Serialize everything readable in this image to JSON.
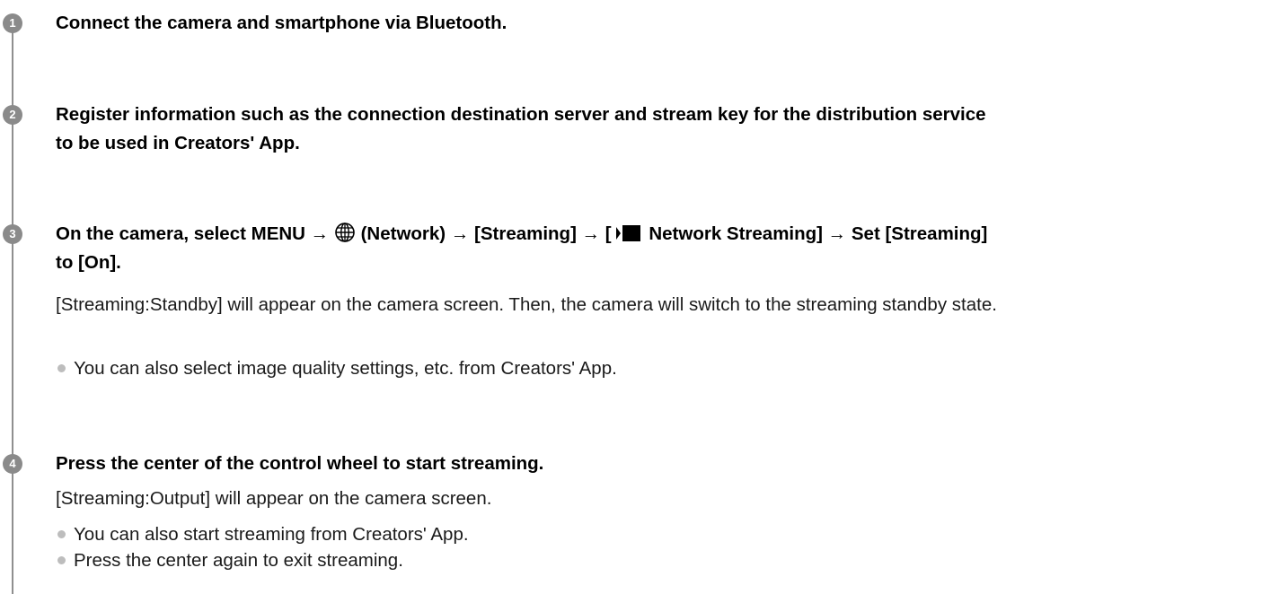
{
  "steps": [
    {
      "number": "1",
      "title": "Connect the camera and smartphone via Bluetooth."
    },
    {
      "number": "2",
      "title_line1": "Register information such as the connection destination server and stream key for the distribution service",
      "title_line2": "to be used in Creators' App."
    },
    {
      "number": "3",
      "title_part1": "On the camera, select MENU → ",
      "title_part2": " (Network) → [Streaming] → [",
      "title_part3": " Network Streaming] → Set [Streaming]",
      "title_line2": "to [On].",
      "description": "[Streaming:Standby] will appear on the camera screen. Then, the camera will switch to the streaming standby state.",
      "bullets": [
        "You can also select image quality settings, etc. from Creators' App."
      ],
      "icons": [
        "globe-network-icon",
        "movie-streaming-icon"
      ]
    },
    {
      "number": "4",
      "title": "Press the center of the control wheel to start streaming.",
      "description": "[Streaming:Output] will appear on the camera screen.",
      "bullets": [
        "You can also start streaming from Creators' App.",
        "Press the center again to exit streaming."
      ]
    }
  ],
  "colors": {
    "step_badge": "#8a8a8a",
    "timeline": "#8f8f8f",
    "bullet_dot": "#bdbdbd",
    "text": "#000000"
  }
}
